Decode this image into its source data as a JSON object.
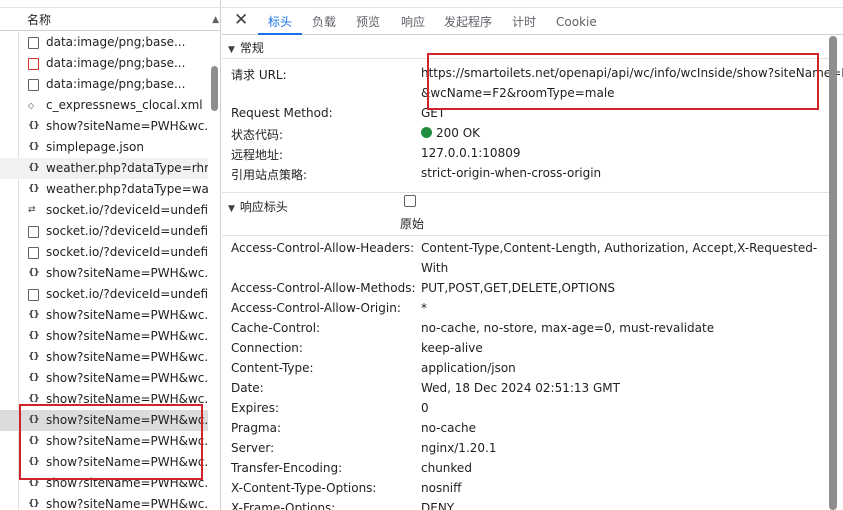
{
  "list": {
    "column_header": "名称",
    "items": [
      {
        "icon": "doc-icon",
        "text": "data:image/png;base..."
      },
      {
        "icon": "image-icon",
        "text": "data:image/png;base..."
      },
      {
        "icon": "doc-icon",
        "text": "data:image/png;base..."
      },
      {
        "icon": "xml-icon",
        "text": "c_expressnews_clocal.xml"
      },
      {
        "icon": "json-icon",
        "text": "show?siteName=PWH&wc..."
      },
      {
        "icon": "json-icon",
        "text": "simplepage.json"
      },
      {
        "icon": "json-icon",
        "text": "weather.php?dataType=rhrr..."
      },
      {
        "icon": "json-icon",
        "text": "weather.php?dataType=war..."
      },
      {
        "icon": "socket-icon",
        "text": "socket.io/?deviceId=undefi..."
      },
      {
        "icon": "doc-icon",
        "text": "socket.io/?deviceId=undefi..."
      },
      {
        "icon": "doc-icon",
        "text": "socket.io/?deviceId=undefi..."
      },
      {
        "icon": "json-icon",
        "text": "show?siteName=PWH&wc..."
      },
      {
        "icon": "doc-icon",
        "text": "socket.io/?deviceId=undefi..."
      },
      {
        "icon": "json-icon",
        "text": "show?siteName=PWH&wc..."
      },
      {
        "icon": "json-icon",
        "text": "show?siteName=PWH&wc..."
      },
      {
        "icon": "json-icon",
        "text": "show?siteName=PWH&wc..."
      },
      {
        "icon": "json-icon",
        "text": "show?siteName=PWH&wc..."
      },
      {
        "icon": "json-icon",
        "text": "show?siteName=PWH&wc..."
      },
      {
        "icon": "json-icon",
        "text": "show?siteName=PWH&wc..."
      },
      {
        "icon": "json-icon",
        "text": "show?siteName=PWH&wc..."
      },
      {
        "icon": "json-icon",
        "text": "show?siteName=PWH&wc..."
      },
      {
        "icon": "json-icon",
        "text": "show?siteName=PWH&wc..."
      },
      {
        "icon": "json-icon",
        "text": "show?siteName=PWH&wc..."
      }
    ]
  },
  "tabs": [
    "标头",
    "负载",
    "预览",
    "响应",
    "发起程序",
    "计时",
    "Cookie"
  ],
  "active_tab": "标头",
  "general": {
    "title": "常规",
    "request_url_label": "请求 URL:",
    "request_url_line1": "https://smartoilets.net/openapi/api/wc/info/wcInside/show?siteName=PWH",
    "request_url_line2": "&wcName=F2&roomType=male",
    "method_label": "Request Method:",
    "method_value": "GET",
    "status_label": "状态代码:",
    "status_value": "200 OK",
    "remote_label": "远程地址:",
    "remote_value": "127.0.0.1:10809",
    "policy_label": "引用站点策略:",
    "policy_value": "strict-origin-when-cross-origin"
  },
  "response_headers": {
    "title": "响应标头",
    "raw_label": "原始",
    "rows": [
      {
        "name": "Access-Control-Allow-Headers:",
        "value": "Content-Type,Content-Length, Authorization, Accept,X-Requested-",
        "value2": "With"
      },
      {
        "name": "Access-Control-Allow-Methods:",
        "value": "PUT,POST,GET,DELETE,OPTIONS"
      },
      {
        "name": "Access-Control-Allow-Origin:",
        "value": "*"
      },
      {
        "name": "Cache-Control:",
        "value": "no-cache, no-store, max-age=0, must-revalidate"
      },
      {
        "name": "Connection:",
        "value": "keep-alive"
      },
      {
        "name": "Content-Type:",
        "value": "application/json"
      },
      {
        "name": "Date:",
        "value": "Wed, 18 Dec 2024 02:51:13 GMT"
      },
      {
        "name": "Expires:",
        "value": "0"
      },
      {
        "name": "Pragma:",
        "value": "no-cache"
      },
      {
        "name": "Server:",
        "value": "nginx/1.20.1"
      },
      {
        "name": "Transfer-Encoding:",
        "value": "chunked"
      },
      {
        "name": "X-Content-Type-Options:",
        "value": "nosniff"
      },
      {
        "name": "X-Frame-Options:",
        "value": "DENY"
      }
    ]
  },
  "colors": {
    "accent": "#1a73e8",
    "highlight_box": "#d0232b",
    "status_ok": "#1e8e3e"
  }
}
